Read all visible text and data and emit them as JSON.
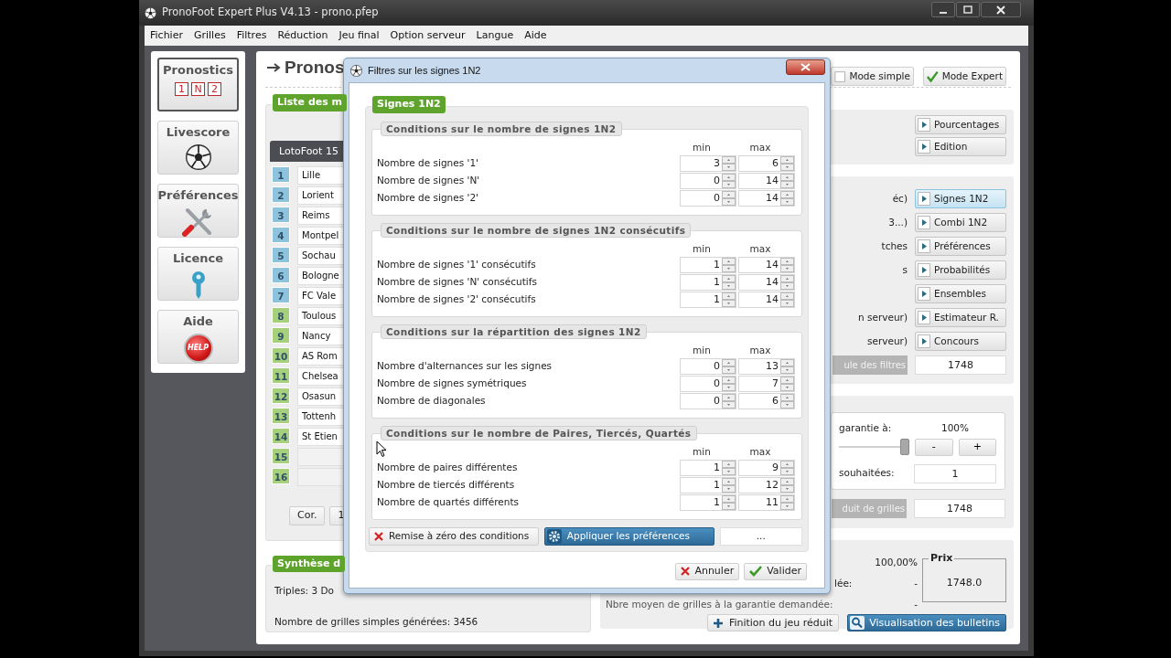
{
  "window": {
    "title": "PronoFoot Expert Plus V4.13 - prono.pfep"
  },
  "menu": [
    "Fichier",
    "Grilles",
    "Filtres",
    "Réduction",
    "Jeu final",
    "Option serveur",
    "Langue",
    "Aide"
  ],
  "sidebar": [
    {
      "label": "Pronostics",
      "kind": "signs",
      "selected": true,
      "signs": [
        "1",
        "N",
        "2"
      ]
    },
    {
      "label": "Livescore",
      "kind": "ball",
      "selected": false
    },
    {
      "label": "Préférences",
      "kind": "tools",
      "selected": false
    },
    {
      "label": "Licence",
      "kind": "key",
      "selected": false
    },
    {
      "label": "Aide",
      "kind": "help",
      "selected": false,
      "icon_text": "HELP"
    }
  ],
  "heading": "Pronos",
  "modes": [
    {
      "label": "Mode simple",
      "checked": false
    },
    {
      "label": "Mode Expert",
      "checked": true
    }
  ],
  "matches": {
    "title": "Liste des m",
    "tab": "LotoFoot 15",
    "rows": [
      {
        "number": "1",
        "name": "Lille",
        "color": "#8ec3de"
      },
      {
        "number": "2",
        "name": "Lorient",
        "color": "#8ec3de"
      },
      {
        "number": "3",
        "name": "Reims",
        "color": "#8ec3de"
      },
      {
        "number": "4",
        "name": "Montpel",
        "color": "#8ec3de"
      },
      {
        "number": "5",
        "name": "Sochau",
        "color": "#8ec3de"
      },
      {
        "number": "6",
        "name": "Bologne",
        "color": "#8ec3de"
      },
      {
        "number": "7",
        "name": "FC Vale",
        "color": "#8ec3de"
      },
      {
        "number": "8",
        "name": "Toulous",
        "color": "#a6d07c"
      },
      {
        "number": "9",
        "name": "Nancy",
        "color": "#a6d07c"
      },
      {
        "number": "10",
        "name": "AS Rom",
        "color": "#a6d07c"
      },
      {
        "number": "11",
        "name": "Chelsea",
        "color": "#a6d07c"
      },
      {
        "number": "12",
        "name": "Osasun",
        "color": "#a6d07c"
      },
      {
        "number": "13",
        "name": "Tottenh",
        "color": "#a6d07c"
      },
      {
        "number": "14",
        "name": "St Etien",
        "color": "#a6d07c"
      },
      {
        "number": "15",
        "color": "#a6d07c"
      },
      {
        "number": "16",
        "color": "#a6d07c"
      }
    ],
    "buttons": [
      "Cor.",
      "1"
    ]
  },
  "summary": {
    "title": "Synthèse d",
    "lines": [
      "Triples: 3 Do",
      "Nombre de grilles simples générées: 3456"
    ]
  },
  "tools": {
    "buttons": [
      "Pourcentages",
      "Edition"
    ]
  },
  "filters": {
    "rows": [
      {
        "label": "éc)",
        "button": "Signes 1N2",
        "selected": true
      },
      {
        "label": "3...)",
        "button": "Combi 1N2",
        "selected": false
      },
      {
        "label": "tches",
        "button": "Préférences",
        "selected": false
      },
      {
        "label": "s",
        "button": "Probabilités",
        "selected": false
      },
      {
        "button": "Ensembles",
        "selected": false
      },
      {
        "label": "n serveur)",
        "button": "Estimateur R.",
        "selected": false
      },
      {
        "label": "serveur)",
        "button": "Concours",
        "selected": false
      }
    ],
    "result": {
      "button": "ule des filtres",
      "disabled": true,
      "value": "1748"
    }
  },
  "reduction": {
    "guarantee_label": "garantie à:",
    "guarantee_value": "100%",
    "level": 1,
    "minus": "-",
    "plus": "+",
    "wanted_label": "souhaitées:",
    "wanted_value": "1",
    "result": {
      "button": "duit de grilles",
      "disabled": true,
      "value": "1748"
    }
  },
  "final": {
    "percent": "100,00%",
    "lines": [
      {
        "label": "lée:",
        "value": "-"
      },
      {
        "label": "Nbre moyen de grilles à la garantie demandée:",
        "value": "-"
      }
    ],
    "price_title": "Prix",
    "price": "1748.0",
    "buttons": [
      {
        "label": "Finition du jeu réduit",
        "kind": "plain"
      },
      {
        "label": "Visualisation des bulletins",
        "kind": "primary"
      }
    ]
  },
  "dialog": {
    "title": "Filtres sur les signes 1N2",
    "tab": "Signes 1N2",
    "sections": [
      {
        "title": "Conditions sur le nombre de signes 1N2",
        "columns": [
          "min",
          "max"
        ],
        "rows": [
          {
            "label": "Nombre de signes '1'",
            "min": "3",
            "max": "6"
          },
          {
            "label": "Nombre de signes 'N'",
            "min": "0",
            "max": "14"
          },
          {
            "label": "Nombre de signes '2'",
            "min": "0",
            "max": "14"
          }
        ]
      },
      {
        "title": "Conditions sur le nombre de signes 1N2 consécutifs",
        "columns": [
          "min",
          "max"
        ],
        "rows": [
          {
            "label": "Nombre de signes '1' consécutifs",
            "min": "1",
            "max": "14"
          },
          {
            "label": "Nombre de signes 'N' consécutifs",
            "min": "1",
            "max": "14"
          },
          {
            "label": "Nombre de signes '2' consécutifs",
            "min": "1",
            "max": "14"
          }
        ]
      },
      {
        "title": "Conditions sur la répartition des signes 1N2",
        "columns": [
          "min",
          "max"
        ],
        "rows": [
          {
            "label": "Nombre d'alternances sur les signes",
            "min": "0",
            "max": "13"
          },
          {
            "label": "Nombre de signes symétriques",
            "min": "0",
            "max": "7"
          },
          {
            "label": "Nombre de diagonales",
            "min": "0",
            "max": "6"
          }
        ]
      },
      {
        "title": "Conditions sur le nombre de Paires, Tiercés, Quartés",
        "columns": [
          "min",
          "max"
        ],
        "rows": [
          {
            "label": "Nombre de paires différentes",
            "min": "1",
            "max": "9"
          },
          {
            "label": "Nombre de tiercés différents",
            "min": "1",
            "max": "12"
          },
          {
            "label": "Nombre de quartés différents",
            "min": "1",
            "max": "11"
          }
        ]
      }
    ],
    "actions": [
      {
        "label": "Remise à zéro des conditions",
        "kind": "reset"
      },
      {
        "label": "Appliquer les préférences",
        "kind": "apply"
      },
      {
        "label": "...",
        "kind": "more"
      }
    ],
    "buttons": [
      {
        "label": "Annuler",
        "kind": "cancel"
      },
      {
        "label": "Valider",
        "kind": "ok"
      }
    ]
  }
}
